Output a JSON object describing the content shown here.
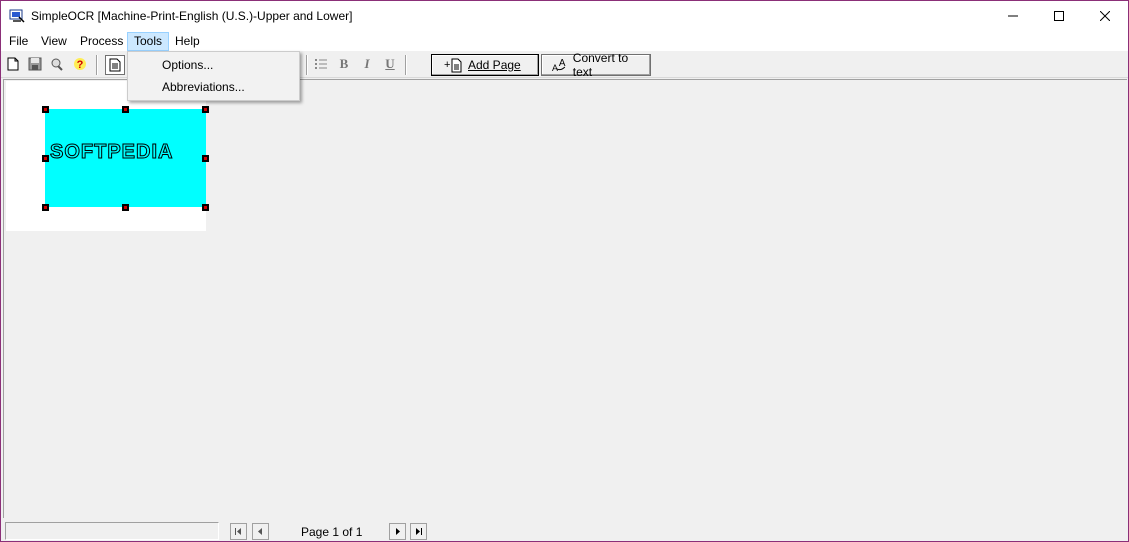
{
  "window": {
    "title": "SimpleOCR [Machine-Print-English (U.S.)-Upper and Lower]",
    "controls": {
      "minimize_icon": "minimize-icon",
      "maximize_icon": "maximize-icon",
      "close_icon": "close-icon"
    }
  },
  "menu": {
    "items": [
      {
        "label": "File"
      },
      {
        "label": "View"
      },
      {
        "label": "Process"
      },
      {
        "label": "Tools",
        "active": true
      },
      {
        "label": "Help"
      }
    ]
  },
  "tools_menu": {
    "items": [
      {
        "label": "Options..."
      },
      {
        "label": "Abbreviations..."
      }
    ]
  },
  "toolbar": {
    "icons": [
      "new-document-icon",
      "save-icon",
      "scan-icon",
      "help-icon",
      "page-icon",
      "bullets-icon",
      "bold-icon",
      "italic-icon",
      "underline-icon"
    ],
    "bold_label": "B",
    "italic_label": "I",
    "underline_label": "U",
    "add_page_label": "Add Page",
    "convert_label": "Convert to text"
  },
  "document": {
    "ocr_text": "SOFTPEDIA",
    "selection_color": "#00ffff",
    "watermark": "SOFTPEDIA"
  },
  "statusbar": {
    "page_label": "Page 1 of 1"
  }
}
